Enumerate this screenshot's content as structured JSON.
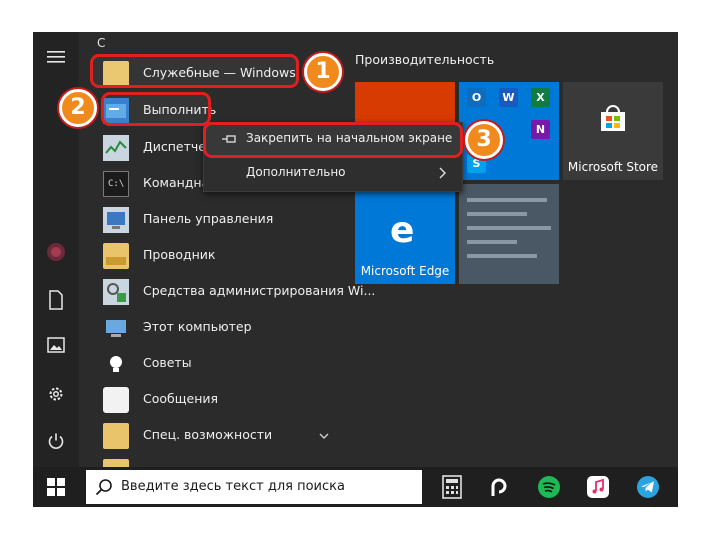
{
  "start_menu": {
    "section_letter": "С",
    "apps": [
      {
        "label": "Служебные — Windows",
        "icon": "folder-icon"
      },
      {
        "label": "Выполнить",
        "icon": "run-icon"
      },
      {
        "label": "Диспетчер",
        "icon": "task-manager-icon"
      },
      {
        "label": "Командная",
        "icon": "command-prompt-icon"
      },
      {
        "label": "Панель управления",
        "icon": "control-panel-icon"
      },
      {
        "label": "Проводник",
        "icon": "file-explorer-icon"
      },
      {
        "label": "Средства администрирования Wi...",
        "icon": "admin-tools-icon"
      },
      {
        "label": "Этот компьютер",
        "icon": "this-pc-icon"
      },
      {
        "label": "Советы",
        "icon": "tips-icon"
      },
      {
        "label": "Сообщения",
        "icon": "messages-icon"
      },
      {
        "label": "Спец. возможности",
        "icon": "folder-icon"
      }
    ],
    "tiles_section_title": "Производительность",
    "tiles": {
      "store": "Microsoft Store",
      "edge": "Microsoft Edge"
    },
    "mini_tiles": [
      "O",
      "W",
      "X",
      "N",
      "S"
    ]
  },
  "context_menu": {
    "pin_label": "Закрепить на начальном экране",
    "more_label": "Дополнительно"
  },
  "callouts": {
    "one": "1",
    "two": "2",
    "three": "3"
  },
  "taskbar": {
    "search_placeholder": "Введите здесь текст для поиска"
  },
  "colors": {
    "accent_blue": "#0078d7",
    "callout_red": "#e02020",
    "badge_orange": "#f08a1c",
    "office_red": "#d83b01"
  }
}
